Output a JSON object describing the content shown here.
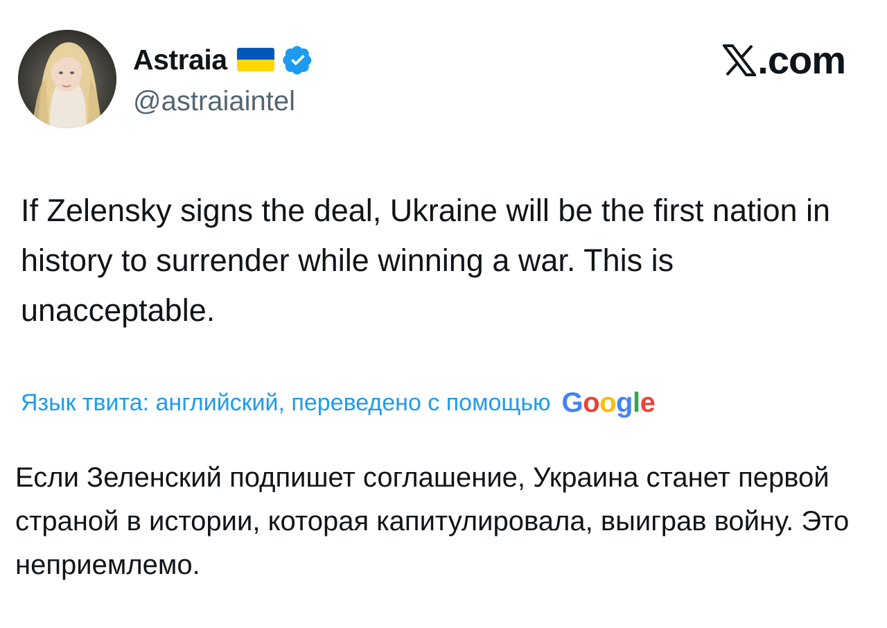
{
  "author": {
    "display_name": "Astraia",
    "handle": "@astraiaintel",
    "flag_icon": "ukraine-flag-icon",
    "flag_colors": [
      "#0057b7",
      "#ffd700"
    ],
    "verified_icon": "verified-badge-icon",
    "verified_color": "#1d9bf0",
    "avatar_icon": "avatar"
  },
  "brand": {
    "label": ".com",
    "icon": "x-logo-icon"
  },
  "tweet": {
    "text": "If Zelensky signs the deal, Ukraine will be the first nation in history to surrender while winning a war. This is unacceptable."
  },
  "translation": {
    "note": "Язык твита: английский, переведено с помощью",
    "provider": {
      "letters": [
        "G",
        "o",
        "o",
        "g",
        "l",
        "e"
      ],
      "colors": [
        "#4285f4",
        "#ea4335",
        "#fbbc05",
        "#4285f4",
        "#34a853",
        "#ea4335"
      ]
    },
    "text": "Если Зеленский подпишет соглашение, Украина станет первой страной в истории, которая капитулировала, выиграв войну. Это неприемлемо.",
    "link_color": "#1d9bf0"
  }
}
